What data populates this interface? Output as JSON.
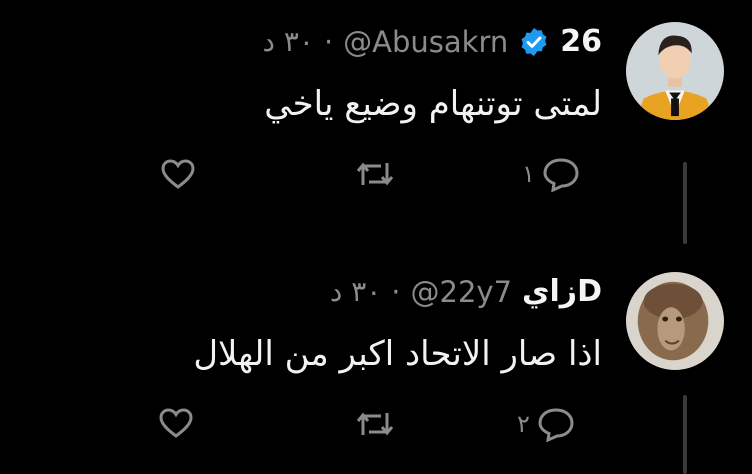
{
  "tweets": [
    {
      "display_name": "26",
      "verified": true,
      "handle": "@Abusakrn",
      "separator": "·",
      "time": "٣٠ د",
      "text": "لمتى توتنهام وضيع ياخي",
      "reply_count": "١",
      "retweet_count": "",
      "like_count": "",
      "avatar": "man-orange-suit-avatar"
    },
    {
      "display_name": "زايD",
      "verified": false,
      "handle": "@22y7",
      "separator": "·",
      "time": "٣٠ د",
      "text": "اذا صار الاتحاد اكبر من الهلال",
      "reply_count": "٢",
      "retweet_count": "",
      "like_count": "",
      "avatar": "camel-avatar"
    }
  ],
  "colors": {
    "background": "#000000",
    "text": "#f2f2f2",
    "muted": "#8b8b8b",
    "verified": "#1d9bf0",
    "thread_line": "#3a3a3a"
  },
  "icons": [
    "verified-badge-icon",
    "reply-icon",
    "retweet-icon",
    "like-icon"
  ]
}
